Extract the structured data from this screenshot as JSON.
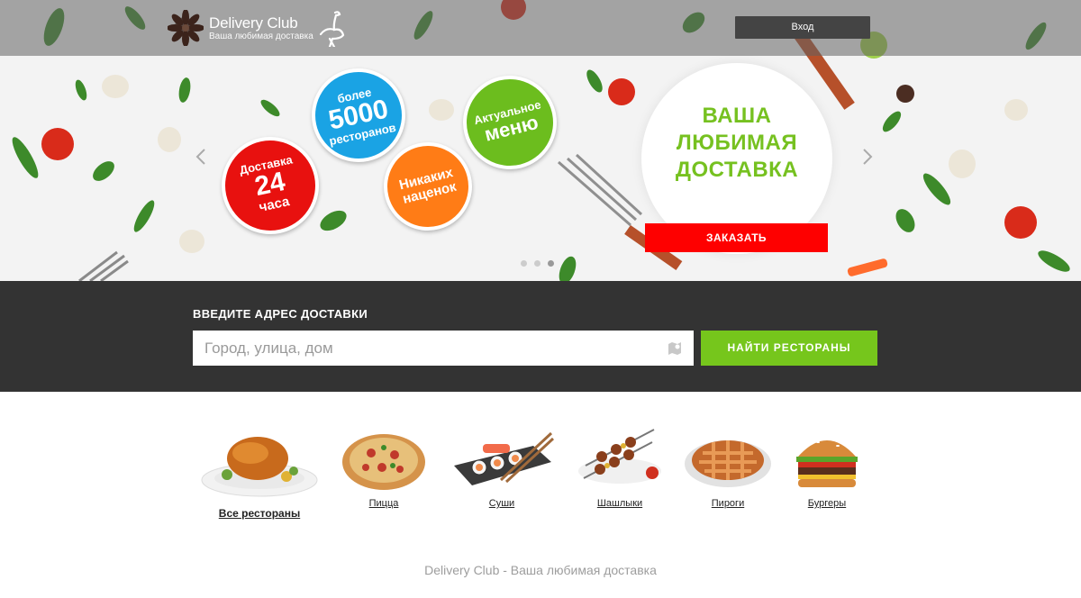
{
  "header": {
    "logo_title": "Delivery Club",
    "logo_subtitle": "Ваша любимая доставка",
    "login_label": "Вход"
  },
  "hero": {
    "badges": [
      {
        "line1": "Доставка",
        "line2": "24",
        "line3": "часа",
        "color": "#e8110f"
      },
      {
        "line1": "более",
        "line2": "5000",
        "line3": "ресторанов",
        "color": "#1aa3e4"
      },
      {
        "line1": "Никаких",
        "line2": "наценок",
        "color": "#ff7c16"
      },
      {
        "line1": "Актуальное",
        "line2": "меню",
        "color": "#6cbd1e"
      }
    ],
    "title_lines": [
      "ВАША",
      "ЛЮБИМАЯ",
      "ДОСТАВКА"
    ],
    "order_label": "ЗАКАЗАТЬ",
    "slide_count": 3,
    "active_slide": 3
  },
  "search": {
    "label": "ВВЕДИТЕ АДРЕС ДОСТАВКИ",
    "placeholder": "Город, улица, дом",
    "value": "",
    "button_label": "НАЙТИ РЕСТОРАНЫ"
  },
  "categories": [
    {
      "label": "Все рестораны",
      "icon": "roast-chicken-icon"
    },
    {
      "label": "Пицца",
      "icon": "pizza-icon"
    },
    {
      "label": "Суши",
      "icon": "sushi-icon"
    },
    {
      "label": "Шашлыки",
      "icon": "kebab-icon"
    },
    {
      "label": "Пироги",
      "icon": "pie-icon"
    },
    {
      "label": "Бургеры",
      "icon": "burger-icon"
    }
  ],
  "footer": {
    "text": "Delivery Club - Ваша любимая доставка"
  },
  "colors": {
    "brand_green": "#76c61c",
    "order_red": "#fe0000",
    "search_bg": "#333333"
  }
}
